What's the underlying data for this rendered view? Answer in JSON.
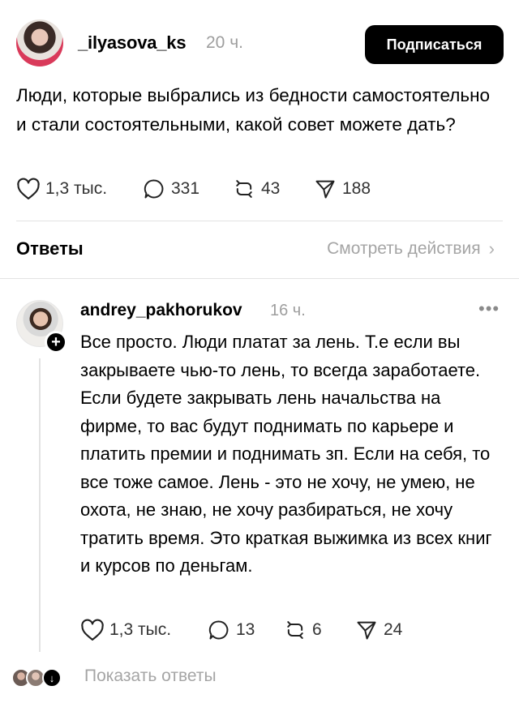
{
  "post": {
    "username": "_ilyasova_ks",
    "time": "20 ч.",
    "follow_label": "Подписаться",
    "text": "Люди, которые выбрались из бедности самостоятельно и стали состоятельными, какой совет можете дать?",
    "likes": "1,3 тыс.",
    "comments": "331",
    "reposts": "43",
    "shares": "188"
  },
  "replies_header": {
    "title": "Ответы",
    "activity_link": "Смотреть действия"
  },
  "reply": {
    "username": "andrey_pakhorukov",
    "time": "16 ч.",
    "more": "•••",
    "text": "Все просто. Люди платат за лень. Т.е если вы закрываете чью-то лень, то всегда заработаете. Если будете закрывать лень начальства на фирме, то вас будут поднимать по карьере и платить премии и поднимать зп. Если на себя, то все тоже самое. Лень - это не хочу, не умею, не охота, не знаю, не хочу разбираться, не хочу тратить время. Это краткая выжимка из всех книг и курсов по деньгам.",
    "likes": "1,3 тыс.",
    "comments": "13",
    "reposts": "6",
    "shares": "24"
  },
  "footer": {
    "show_replies": "Показать ответы"
  },
  "colors": {
    "text": "#000000",
    "muted": "#9e9e9e",
    "divider": "#e3e3e3",
    "button_bg": "#000000",
    "button_text": "#ffffff"
  },
  "icons": [
    "heart-icon",
    "comment-icon",
    "repost-icon",
    "share-icon",
    "chevron-right-icon",
    "plus-icon",
    "more-icon"
  ]
}
